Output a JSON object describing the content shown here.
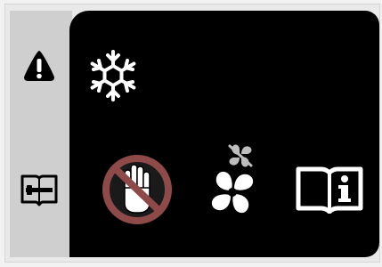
{
  "display": {
    "status_readout": "",
    "colors": {
      "screen_background": "#000000",
      "side_panel": "#cfcfcf",
      "icon_white": "#ffffff",
      "prohibit_red": "#c0504d",
      "icon_black": "#000000"
    }
  },
  "side_icons": [
    {
      "name": "warning-icon",
      "interactable": true
    },
    {
      "name": "maintenance-manual-icon",
      "interactable": true
    }
  ],
  "main_icons": [
    {
      "name": "snowflake-icon",
      "interactable": false
    },
    {
      "name": "no-touch-icon",
      "interactable": true
    },
    {
      "name": "fan-icon",
      "interactable": true
    },
    {
      "name": "fan-muted-icon",
      "interactable": false
    },
    {
      "name": "info-manual-icon",
      "interactable": true
    }
  ]
}
